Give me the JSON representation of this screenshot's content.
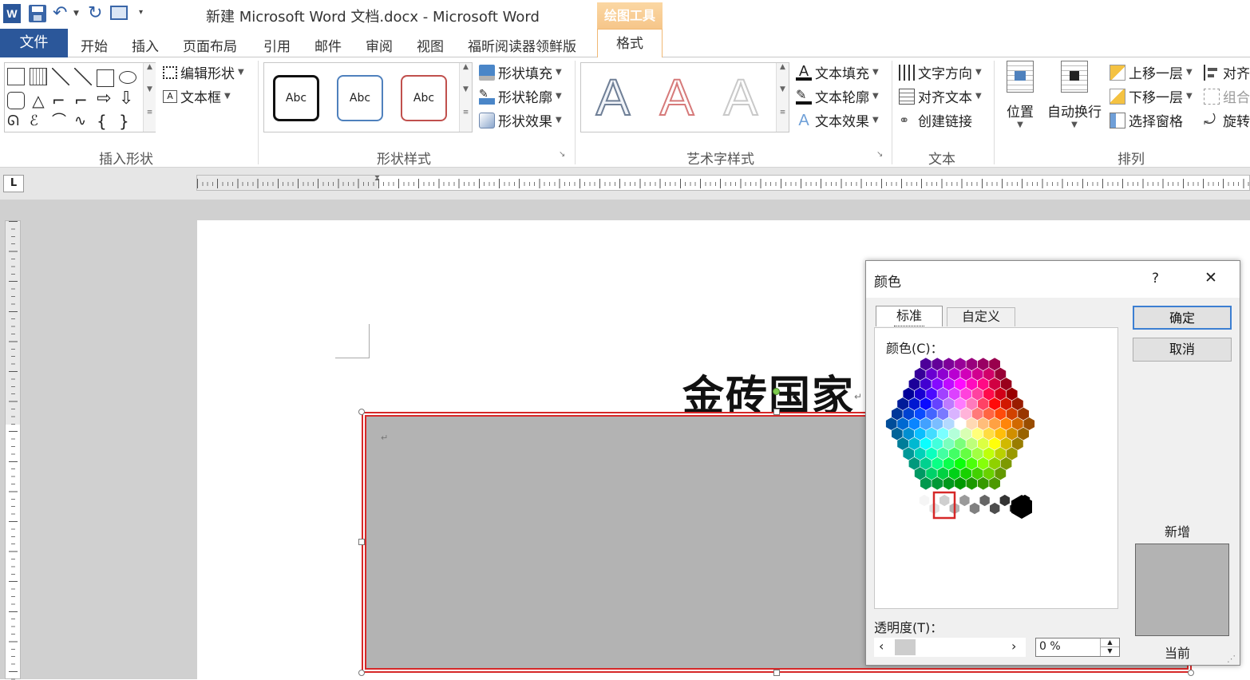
{
  "window": {
    "title": "新建 Microsoft Word 文档.docx - Microsoft Word",
    "context_tool_label": "绘图工具"
  },
  "tabs": {
    "file": "文件",
    "home": "开始",
    "insert": "插入",
    "layout": "页面布局",
    "references": "引用",
    "mailings": "邮件",
    "review": "审阅",
    "view": "视图",
    "foxit": "福昕阅读器领鲜版",
    "format": "格式"
  },
  "ribbon": {
    "insert_shapes": {
      "label": "插入形状",
      "edit_shape": "编辑形状",
      "textbox": "文本框"
    },
    "shape_styles": {
      "label": "形状样式",
      "samples": [
        "Abc",
        "Abc",
        "Abc"
      ],
      "fill": "形状填充",
      "outline": "形状轮廓",
      "effects": "形状效果"
    },
    "wordart": {
      "label": "艺术字样式",
      "samples": [
        "A",
        "A",
        "A"
      ],
      "text_fill": "文本填充",
      "text_outline": "文本轮廓",
      "text_effects": "文本效果"
    },
    "text": {
      "label": "文本",
      "direction": "文字方向",
      "align": "对齐文本",
      "link": "创建链接"
    },
    "arrange": {
      "label": "排列",
      "position": "位置",
      "wrap": "自动换行",
      "bring_forward": "上移一层",
      "send_backward": "下移一层",
      "selection_pane": "选择窗格",
      "align": "对齐",
      "group": "组合",
      "rotate": "旋转"
    }
  },
  "ruler": {
    "corner": "L"
  },
  "document": {
    "heading": "金砖国家",
    "para_mark": "↵"
  },
  "dialog": {
    "title": "颜色",
    "help": "?",
    "close": "✕",
    "tab_standard": "标准",
    "tab_custom": "自定义",
    "colors_label": "颜色(C)：",
    "ok": "确定",
    "cancel": "取消",
    "new_label": "新增",
    "current_label": "当前",
    "transparency_label": "透明度(T)：",
    "transparency_value": "0 %",
    "new_color": "#b3b3b3",
    "current_color": "#b3b3b3"
  },
  "colors": {
    "accent_tab": "#f6c68a",
    "selection_red": "#d62828",
    "shape_fill": "#b3b3b3",
    "dialog_bg": "#f0f0f0"
  }
}
